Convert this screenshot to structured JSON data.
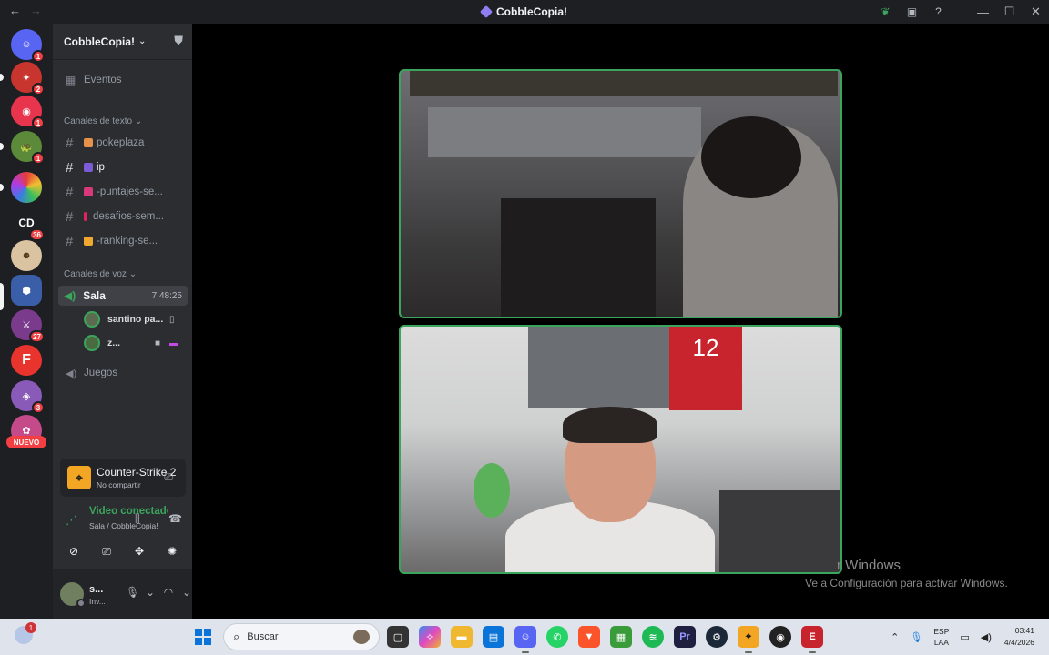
{
  "window": {
    "title": "CobbleCopia!"
  },
  "rail": {
    "badges": [
      "1",
      "2",
      "1",
      "1",
      "36",
      "27",
      "3"
    ],
    "cd_label": "CD",
    "new_label": "NUEVO",
    "colors": {
      "discord_blurple": "#5865f2",
      "red": "#f23f43",
      "green": "#3ba55d"
    }
  },
  "sidebar": {
    "guild_name": "CobbleCopia!",
    "events_label": "Eventos",
    "text_category": "Canales de texto",
    "text_channels": [
      {
        "name": "pokeplaza",
        "emoji_color": "#e8914a"
      },
      {
        "name": "ip",
        "emoji_color": "#7b5cd6"
      },
      {
        "name": "-puntajes-se...",
        "emoji_color": "#d9387a"
      },
      {
        "name": "desafios-sem...",
        "emoji_color": "#e0245e"
      },
      {
        "name": "-ranking-se...",
        "emoji_color": "#f0a830"
      }
    ],
    "voice_category": "Canales de voz",
    "voice_channel": {
      "name": "Sala",
      "time": "7:48:25"
    },
    "voice_users": [
      {
        "name": "santino pa..."
      },
      {
        "name": "z..."
      }
    ],
    "voice_channel_2": "Juegos"
  },
  "activity": {
    "game": "Counter-Strike 2",
    "status": "No compartir"
  },
  "rtc": {
    "title": "Video conectado",
    "subtitle": "Sala / CobbleCopia!"
  },
  "user": {
    "name": "s...",
    "status": "Inv..."
  },
  "stage": {
    "watermark_line1": "r Windows",
    "watermark_line2": "Ve a Configuración para activar Windows.",
    "jersey_number": "12"
  },
  "taskbar": {
    "weather_badge": "1",
    "search_placeholder": "Buscar",
    "lang_line1": "ESP",
    "lang_line2": "LAA",
    "time": "03:41",
    "date": "4/4/2026"
  }
}
